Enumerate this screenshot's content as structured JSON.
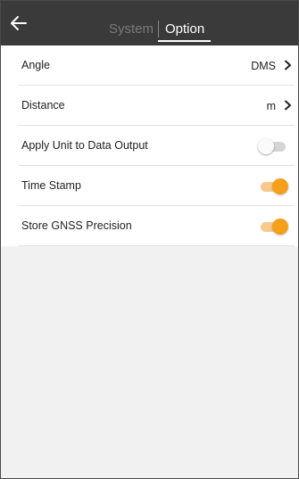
{
  "header": {
    "back_icon": "arrow-left-icon",
    "tabs": [
      {
        "label": "System",
        "active": false
      },
      {
        "label": "Option",
        "active": true
      }
    ]
  },
  "settings": [
    {
      "label": "Angle",
      "value": "DMS",
      "type": "select",
      "icon": "chevron-right-icon"
    },
    {
      "label": "Distance",
      "value": "m",
      "type": "select",
      "icon": "chevron-right-icon"
    },
    {
      "label": "Apply Unit to Data Output",
      "type": "toggle",
      "enabled": false
    },
    {
      "label": "Time Stamp",
      "type": "toggle",
      "enabled": true
    },
    {
      "label": "Store GNSS Precision",
      "type": "toggle",
      "enabled": true
    }
  ],
  "colors": {
    "header_bg": "#3a3a3a",
    "accent": "#f6a01a",
    "accent_track": "#f7c98c",
    "background": "#f1f1f1"
  }
}
